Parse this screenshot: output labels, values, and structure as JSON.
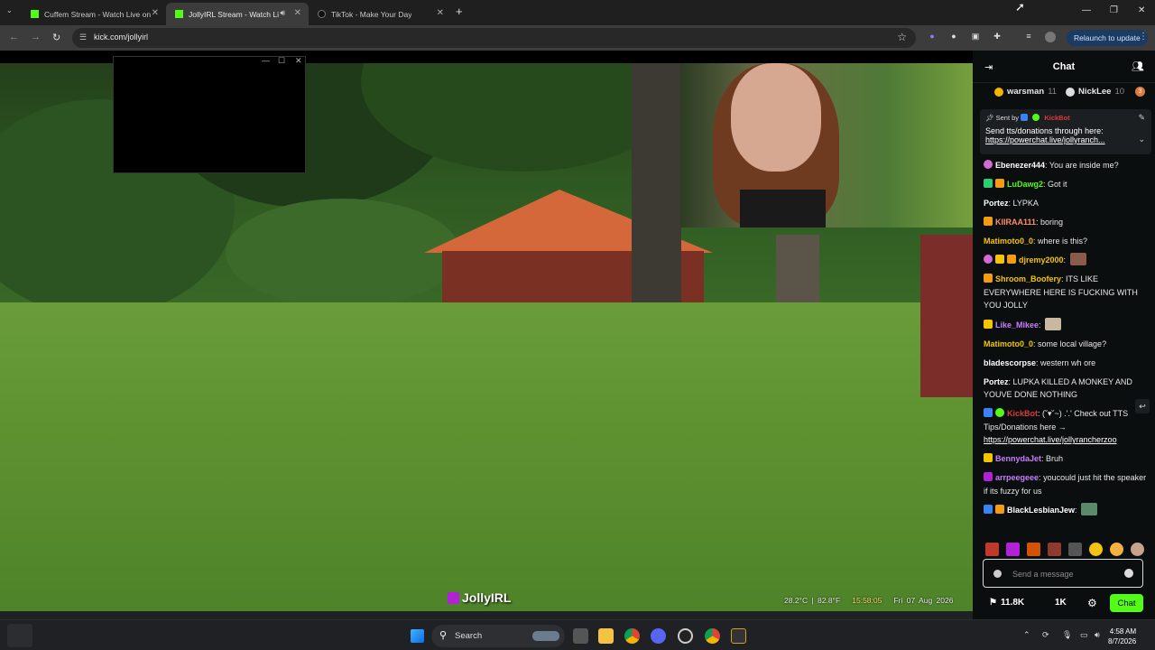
{
  "browser": {
    "tabs": [
      {
        "title": "Cuffem Stream - Watch Live on",
        "active": false
      },
      {
        "title": "JollyIRL Stream - Watch Live",
        "active": true
      },
      {
        "title": "TikTok - Make Your Day",
        "active": false
      }
    ],
    "url": "kick.com/jollyirl",
    "relaunch_label": "Relaunch to update",
    "new_tab": "+"
  },
  "stream": {
    "watermark": "JollyIRL",
    "overlay_temp": "28.2°C | 82.8°F",
    "overlay_time": "15:58:05",
    "overlay_date": "Fri 07 Aug 2026"
  },
  "chat": {
    "title": "Chat",
    "gifters": [
      {
        "name": "warsman",
        "count": "11",
        "color": "#f5b400"
      },
      {
        "name": "NickLee",
        "count": "10",
        "color": "#dddddd"
      }
    ],
    "gifter_more": "3",
    "pinned": {
      "sent_by_label": "Sent by",
      "sender": "KickBot",
      "message": "Send tts/donations through here:",
      "link": "https://powerchat.live/jollyranch..."
    },
    "messages": [
      {
        "user": "Ebenezer444",
        "color": "#ffffff",
        "text": "You are inside me?"
      },
      {
        "user": "LuDawg2",
        "color": "#53fc18",
        "text": "Got it"
      },
      {
        "user": "Portez",
        "color": "#ffffff",
        "text": "LYPKA"
      },
      {
        "user": "KIIRAA111",
        "color": "#ff8c69",
        "text": "boring"
      },
      {
        "user": "Matimoto0_0",
        "color": "#f5c400",
        "text": "where is this?"
      },
      {
        "user": "djremy2000",
        "color": "#f5c400",
        "text": ""
      },
      {
        "user": "Shroom_Boofery",
        "color": "#f5c400",
        "text": "ITS LIKE EVERYWHERE HERE IS FUCKING WITH YOU JOLLY"
      },
      {
        "user": "Like_Mikee",
        "color": "#c77dff",
        "text": ""
      },
      {
        "user": "Matimoto0_0",
        "color": "#f5c400",
        "text": "some local village?"
      },
      {
        "user": "bladescorpse",
        "color": "#ffffff",
        "text": "western wh ore"
      },
      {
        "user": "Portez",
        "color": "#ffffff",
        "text": "LUPKA KILLED A MONKEY AND YOUVE DONE NOTHING"
      },
      {
        "user": "KickBot",
        "color": "#e0363b",
        "text": "(˘▾˘~) .'.' Check out TTS Tips/Donations here →",
        "link": "https://powerchat.live/jollyrancherzoo"
      },
      {
        "user": "BennydaJet",
        "color": "#c77dff",
        "text": "Bruh"
      },
      {
        "user": "arrpeegeee",
        "color": "#c77dff",
        "text": "youcould just hit the speaker if its fuzzy for us"
      },
      {
        "user": "BlackLesbianJew",
        "color": "#ffffff",
        "text": ""
      }
    ],
    "input_placeholder": "Send a message",
    "viewers": "11.8K",
    "followers": "1K",
    "chat_button": "Chat"
  },
  "taskbar": {
    "search_label": "Search",
    "time": "4:58 AM",
    "date": "8/7/2026"
  }
}
